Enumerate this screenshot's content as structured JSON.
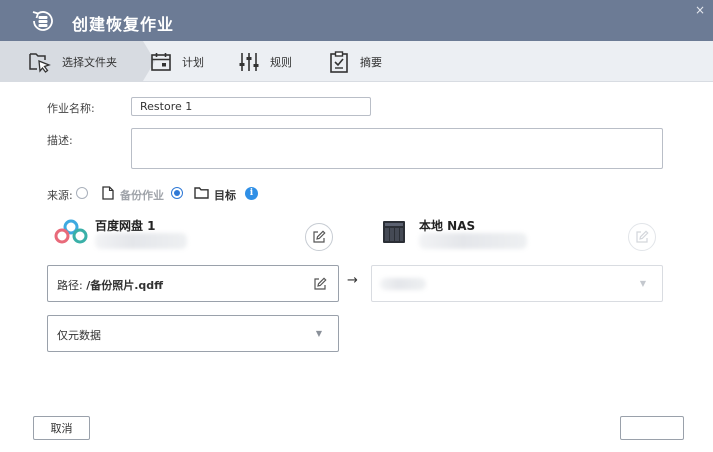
{
  "window": {
    "title": "创建恢复作业",
    "close_glyph": "×"
  },
  "steps": [
    {
      "label": "选择文件夹",
      "icon": "select-folder-icon",
      "active": true
    },
    {
      "label": "计划",
      "icon": "calendar-icon",
      "active": false
    },
    {
      "label": "规则",
      "icon": "sliders-icon",
      "active": false
    },
    {
      "label": "摘要",
      "icon": "clipboard-icon",
      "active": false
    }
  ],
  "form": {
    "job_name_label": "作业名称:",
    "job_name_value": "Restore 1",
    "description_label": "描述:",
    "description_value": "",
    "source_label": "来源:",
    "source_options": [
      {
        "label": "备份作业",
        "checked": false,
        "enabled": false
      },
      {
        "label": "目标",
        "checked": true,
        "enabled": true
      }
    ],
    "info_glyph": "i"
  },
  "source": {
    "name": "百度网盘 1",
    "path_label": "路径:",
    "path_value": "/备份照片.qdff",
    "data_option": "仅元数据"
  },
  "destination": {
    "name": "本地 NAS",
    "location_value": ""
  },
  "arrow_glyph": "→",
  "dropdown_glyph": "▼",
  "footer": {
    "cancel_label": "取消"
  },
  "colors": {
    "titlebar": "#6c7b95",
    "step_bar": "#eceff3",
    "step_active": "#d7dbe1",
    "accent": "#2f79d6"
  }
}
